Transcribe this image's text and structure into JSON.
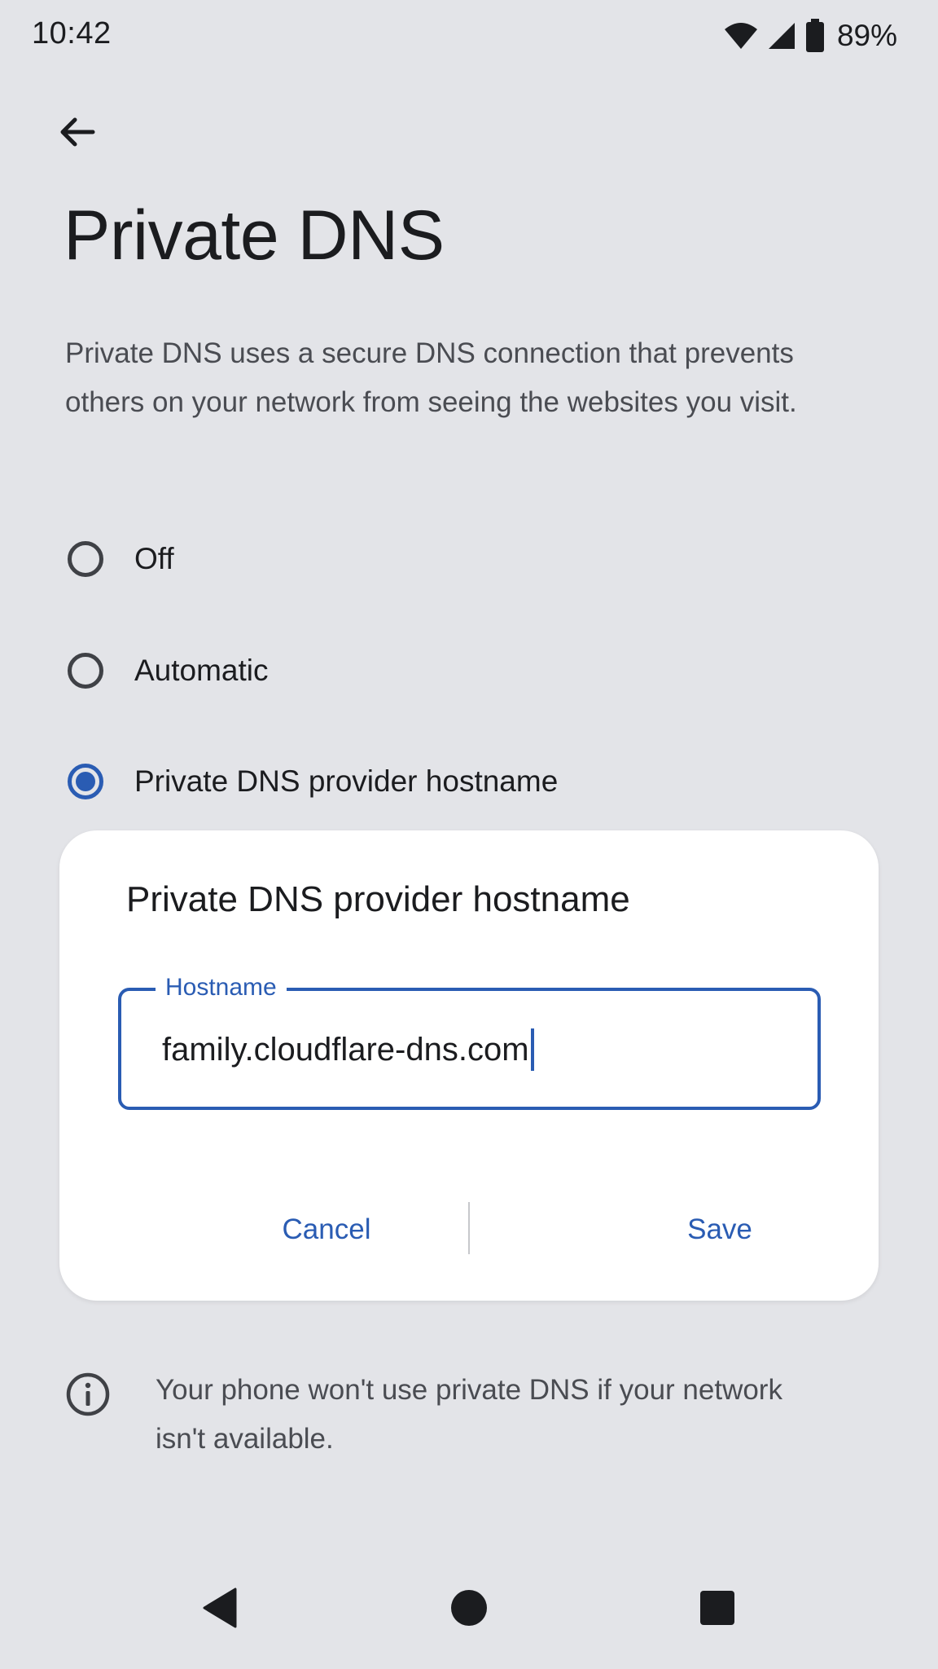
{
  "status_bar": {
    "time": "10:42",
    "battery_percent": "89%",
    "icons": [
      "wifi-icon",
      "cell-signal-icon",
      "battery-icon"
    ]
  },
  "top_bar": {
    "back_icon": "arrow-back-icon"
  },
  "page": {
    "title": "Private DNS",
    "description": "Private DNS uses a secure DNS connection that prevents others on your network from seeing the websites you visit."
  },
  "options": [
    {
      "label": "Off",
      "selected": false
    },
    {
      "label": "Automatic",
      "selected": false
    },
    {
      "label": "Private DNS provider hostname",
      "selected": true
    }
  ],
  "dialog": {
    "title": "Private DNS provider hostname",
    "field_label": "Hostname",
    "field_value": "family.cloudflare-dns.com",
    "cancel_label": "Cancel",
    "save_label": "Save"
  },
  "info": {
    "icon": "info-icon",
    "text": "Your phone won't use private DNS if your network isn't available."
  },
  "nav_bar": {
    "icons": [
      "nav-back-icon",
      "nav-home-icon",
      "nav-recents-icon"
    ]
  },
  "colors": {
    "background": "#e3e4e8",
    "accent": "#2a5cb3",
    "dialog_surface": "#ffffff",
    "text_primary": "#1b1c1f",
    "text_secondary": "#4a4c52"
  }
}
